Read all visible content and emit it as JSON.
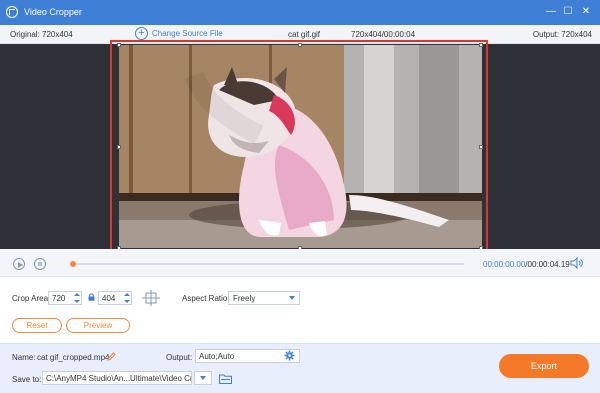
{
  "window": {
    "title": "Video Cropper",
    "minimize_glyph": "—",
    "maximize_glyph": "☐",
    "close_glyph": "✕"
  },
  "infobar": {
    "original": "Original: 720x404",
    "change_source": "Change Source File",
    "file_name": "cat gif.gif",
    "file_meta": "720x404/00:00:04",
    "output": "Output: 720x404"
  },
  "playback": {
    "current_time": "00:00:00.00",
    "total_time": "/00:00:04.19",
    "progress": 0
  },
  "crop": {
    "area_label": "Crop Area:",
    "width": "720",
    "height": "404",
    "aspect_label": "Aspect Ratio:",
    "aspect_value": "Freely",
    "reset_label": "Reset",
    "preview_label": "Preview"
  },
  "footer": {
    "name_label": "Name:",
    "name_value": "cat gif_cropped.mp4",
    "output_label": "Output:",
    "output_value": "Auto;Auto",
    "save_label": "Save to:",
    "save_path": "C:\\AnyMP4 Studio\\An...Ultimate\\Video Crop",
    "export_label": "Export"
  },
  "colors": {
    "titlebar": "#3f7fd6",
    "accent": "#f08a3c",
    "export": "#f47a2a",
    "crop_border": "#e0342a"
  },
  "icons": [
    "app-logo-icon",
    "minimize-icon",
    "maximize-icon",
    "close-icon",
    "add-circle-icon",
    "play-icon",
    "stop-icon",
    "volume-icon",
    "lock-icon",
    "center-crop-icon",
    "edit-pencil-icon",
    "gear-icon",
    "folder-icon",
    "chevron-down-icon"
  ]
}
